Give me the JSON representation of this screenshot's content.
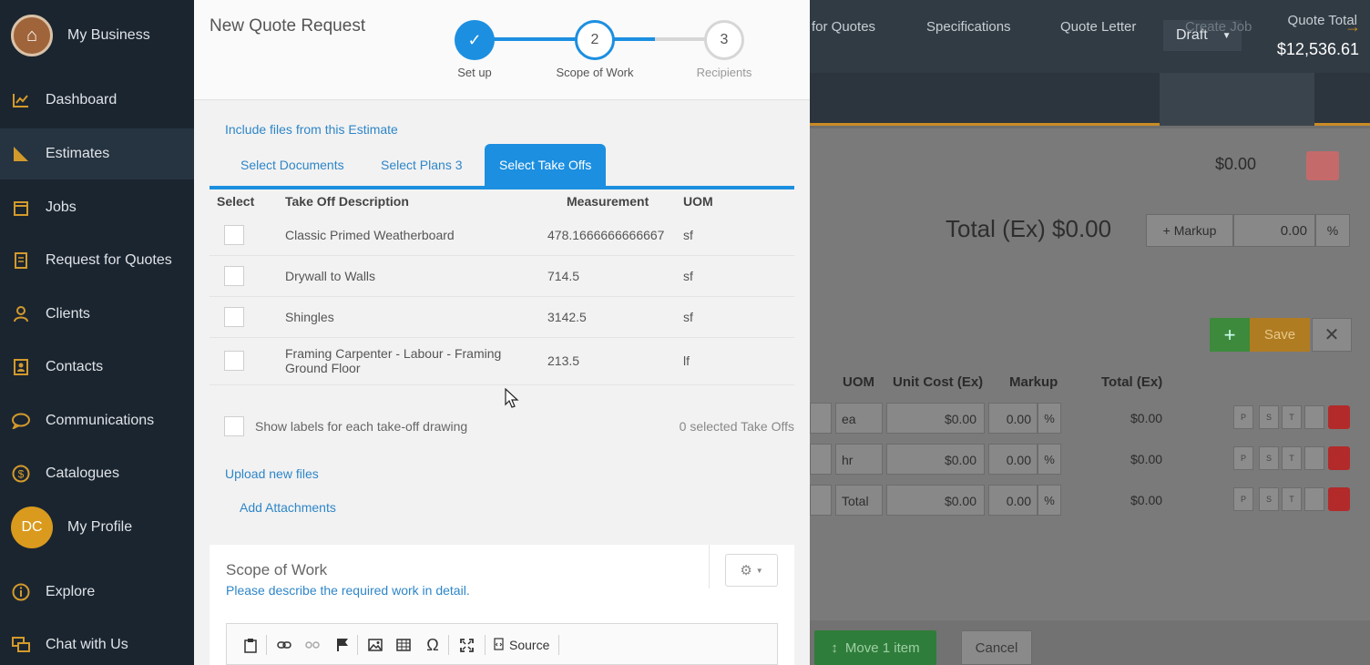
{
  "sidebar": {
    "brand": "My Business",
    "items": [
      {
        "label": "Dashboard",
        "icon": "chart-icon"
      },
      {
        "label": "Estimates",
        "icon": "ruler-icon"
      },
      {
        "label": "Jobs",
        "icon": "calendar-icon"
      },
      {
        "label": "Request for Quotes",
        "icon": "document-icon"
      },
      {
        "label": "Clients",
        "icon": "user-icon"
      },
      {
        "label": "Contacts",
        "icon": "contact-card-icon"
      },
      {
        "label": "Communications",
        "icon": "chat-bubble-icon"
      },
      {
        "label": "Catalogues",
        "icon": "dollar-icon"
      }
    ],
    "profile": {
      "initials": "DC",
      "label": "My Profile"
    },
    "bottom_items": [
      {
        "label": "Explore",
        "icon": "info-icon"
      },
      {
        "label": "Chat with Us",
        "icon": "chat-icon"
      }
    ]
  },
  "modal": {
    "title": "New Quote Request",
    "steps": [
      {
        "number": "✓",
        "label": "Set up",
        "state": "done"
      },
      {
        "number": "2",
        "label": "Scope of Work",
        "state": "current"
      },
      {
        "number": "3",
        "label": "Recipients",
        "state": "pending"
      }
    ],
    "include_label": "Include files from this Estimate",
    "tabs": [
      "Select Documents",
      "Select Plans 3",
      "Select Take Offs"
    ],
    "columns": [
      "Select",
      "Take Off Description",
      "Measurement",
      "UOM"
    ],
    "rows": [
      {
        "description": "Classic Primed Weatherboard",
        "measurement": "478.1666666666667",
        "uom": "sf"
      },
      {
        "description": "Drywall to Walls",
        "measurement": "714.5",
        "uom": "sf"
      },
      {
        "description": "Shingles",
        "measurement": "3142.5",
        "uom": "sf"
      },
      {
        "description": "Framing Carpenter - Labour - Framing Ground Floor",
        "measurement": "213.5",
        "uom": "lf"
      }
    ],
    "show_labels": "Show labels for each take-off drawing",
    "selected_count": "0 selected Take Offs",
    "upload_label": "Upload new files",
    "add_attachments": "Add Attachments",
    "scope_title": "Scope of Work",
    "scope_subtitle": "Please describe the required work in detail.",
    "editor_source": "Source"
  },
  "background": {
    "status": "Draft",
    "quote_total_label": "Quote Total",
    "quote_total_value": "$12,536.61",
    "tabs": [
      "for Quotes",
      "Specifications",
      "Quote Letter",
      "Create Job"
    ],
    "amount": "$0.00",
    "total_label": "Total (Ex) $0.00",
    "markup_button": "+ Markup",
    "markup_value": "0.00",
    "markup_pct": "%",
    "save": "Save",
    "columns": [
      "UOM",
      "Unit Cost (Ex)",
      "Markup",
      "Total (Ex)"
    ],
    "rows": [
      {
        "uom": "ea",
        "cost": "$0.00",
        "markup": "0.00",
        "pct": "%",
        "total": "$0.00"
      },
      {
        "uom": "hr",
        "cost": "$0.00",
        "markup": "0.00",
        "pct": "%",
        "total": "$0.00"
      },
      {
        "uom": "Total",
        "cost": "$0.00",
        "markup": "0.00",
        "pct": "%",
        "total": "$0.00"
      }
    ],
    "row_buttons": [
      "P",
      "S",
      "T"
    ],
    "move_button": "Move 1 item",
    "cancel_button": "Cancel"
  },
  "colors": {
    "accent": "#1c8fe0",
    "sidebar": "#1b2530",
    "gold": "#d39a2b",
    "danger": "#b32a2a",
    "success": "#3d8a3d"
  }
}
